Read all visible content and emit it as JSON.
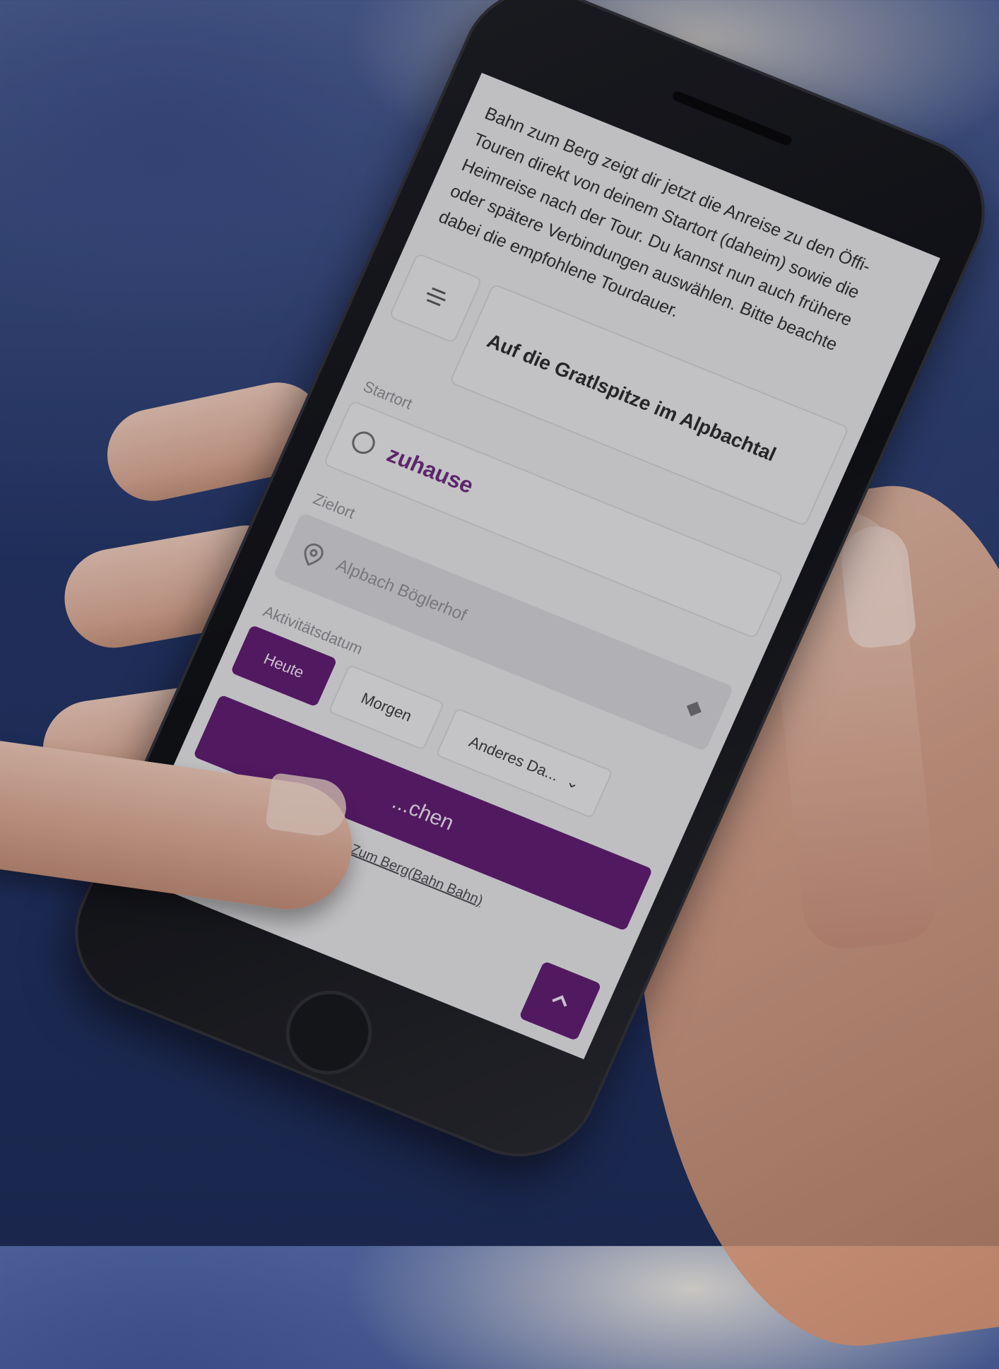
{
  "screen": {
    "intro_text": "Bahn zum Berg zeigt dir jetzt die Anreise zu den Öffi-Touren direkt von deinem Startort (daheim) sowie die Heimreise nach der Tour. Du kannst nun auch frühere oder spätere Verbindungen auswählen. Bitte beachte dabei die empfohlene Tourdauer.",
    "tour_title": "Auf die Gratlspitze im Alpbachtal",
    "start_label": "Startort",
    "start_value": "zuhause",
    "dest_label": "Zielort",
    "dest_value": "Alpbach Böglerhof",
    "date_label": "Aktivitätsdatum",
    "date_options": {
      "today": "Heute",
      "tomorrow": "Morgen",
      "other": "Anderes Da..."
    },
    "search_button": "...chen",
    "footer_link": "...ahn Zum Berg(Bahn Bahn)",
    "icons": {
      "menu": "menu-icon",
      "radio": "radio-icon",
      "pin": "location-pin-icon",
      "diamond": "diamond-icon",
      "chevron": "chevron-down-icon",
      "up": "chevron-up-icon"
    },
    "colors": {
      "accent": "#5e1a6e",
      "background": "#e5e5e6"
    }
  }
}
